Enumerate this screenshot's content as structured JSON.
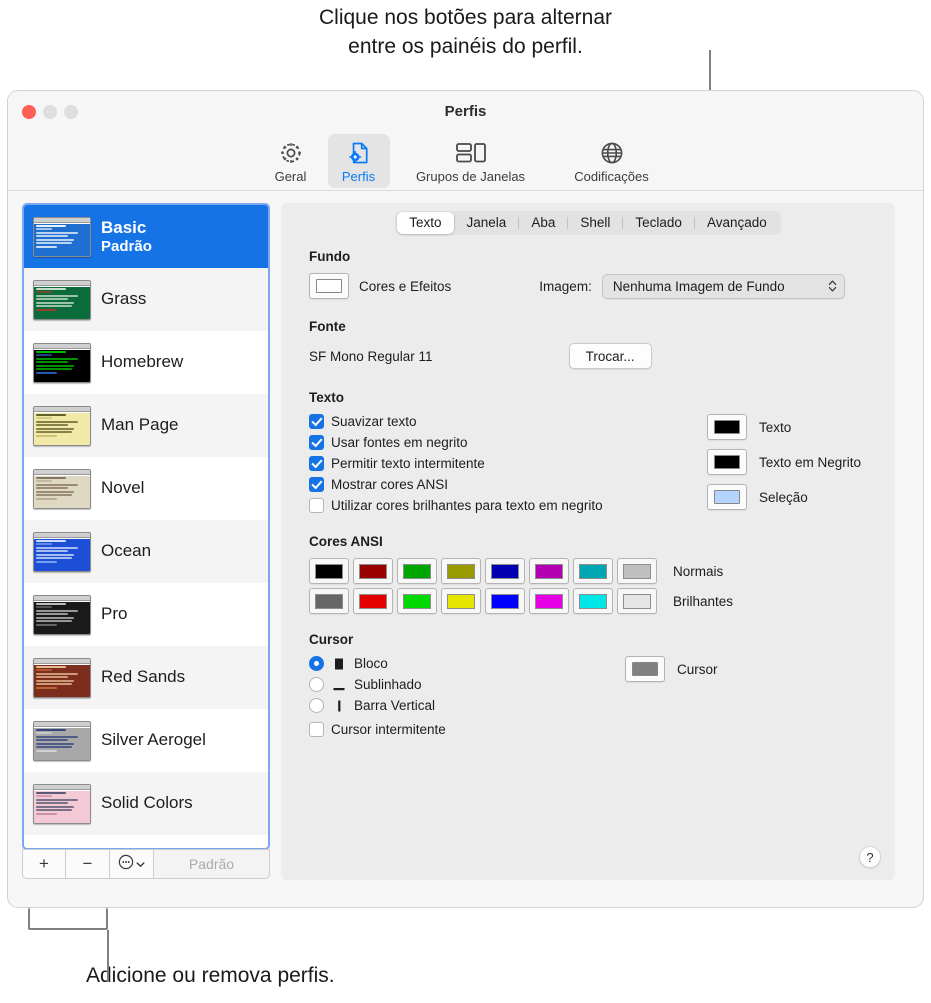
{
  "annotations": {
    "top": "Clique nos botões para alternar\nentre os painéis do perfil.",
    "bottom": "Adicione ou remova perfis."
  },
  "window": {
    "title": "Perfis",
    "traffic_lights": {
      "close": "#ff5f57",
      "minimize": "#dedede",
      "maximize": "#dedede"
    }
  },
  "toolbar": {
    "items": [
      {
        "label": "Geral",
        "icon": "gear-icon",
        "selected": false
      },
      {
        "label": "Perfis",
        "icon": "document-gear-icon",
        "selected": true
      },
      {
        "label": "Grupos de Janelas",
        "icon": "window-groups-icon",
        "selected": false
      },
      {
        "label": "Codificações",
        "icon": "globe-icon",
        "selected": false
      }
    ],
    "accent": "#0a7cf5"
  },
  "profiles": {
    "items": [
      {
        "name": "Basic",
        "subtitle": "Padrão",
        "selected": true,
        "thumb": {
          "bg": "#1f6fd0",
          "fg": "#ffffff",
          "accent": "#dfe9f7"
        }
      },
      {
        "name": "Grass",
        "subtitle": "",
        "selected": false,
        "thumb": {
          "bg": "#0c6b3a",
          "fg": "#d8e8d8",
          "accent": "#9d3f2f"
        }
      },
      {
        "name": "Homebrew",
        "subtitle": "",
        "selected": false,
        "thumb": {
          "bg": "#000000",
          "fg": "#00d000",
          "accent": "#2b5fc8"
        }
      },
      {
        "name": "Man Page",
        "subtitle": "",
        "selected": false,
        "thumb": {
          "bg": "#f2e9a8",
          "fg": "#55521f",
          "accent": "#c9bd72"
        }
      },
      {
        "name": "Novel",
        "subtitle": "",
        "selected": false,
        "thumb": {
          "bg": "#dfd9c3",
          "fg": "#7a6a55",
          "accent": "#b5a98e"
        }
      },
      {
        "name": "Ocean",
        "subtitle": "",
        "selected": false,
        "thumb": {
          "bg": "#1d4fd6",
          "fg": "#e3ecfb",
          "accent": "#7fa6ef"
        }
      },
      {
        "name": "Pro",
        "subtitle": "",
        "selected": false,
        "thumb": {
          "bg": "#1a1a1a",
          "fg": "#cfcfcf",
          "accent": "#6e6e6e"
        }
      },
      {
        "name": "Red Sands",
        "subtitle": "",
        "selected": false,
        "thumb": {
          "bg": "#7c2d1c",
          "fg": "#f0c9a0",
          "accent": "#c4693c"
        }
      },
      {
        "name": "Silver Aerogel",
        "subtitle": "",
        "selected": false,
        "thumb": {
          "bg": "#a8a8a8",
          "fg": "#2b3c7a",
          "accent": "#d4d4d4"
        }
      },
      {
        "name": "Solid Colors",
        "subtitle": "",
        "selected": false,
        "thumb": {
          "bg": "#f2c9d4",
          "fg": "#4a4a6a",
          "accent": "#c78ba0"
        }
      }
    ],
    "toolbar": {
      "add": "+",
      "remove": "−",
      "actions": "actions-menu",
      "default_label": "Padrão"
    }
  },
  "tabs": {
    "items": [
      "Texto",
      "Janela",
      "Aba",
      "Shell",
      "Teclado",
      "Avançado"
    ],
    "active": "Texto"
  },
  "settings": {
    "background": {
      "title": "Fundo",
      "colors_effects_label": "Cores e Efeitos",
      "image_label": "Imagem:",
      "image_value": "Nenhuma Imagem de Fundo",
      "swatch_color": "#ffffff"
    },
    "font": {
      "title": "Fonte",
      "value": "SF Mono Regular 11",
      "change_button": "Trocar..."
    },
    "text": {
      "title": "Texto",
      "checkboxes": [
        {
          "label": "Suavizar texto",
          "checked": true
        },
        {
          "label": "Usar fontes em negrito",
          "checked": true
        },
        {
          "label": "Permitir texto intermitente",
          "checked": true
        },
        {
          "label": "Mostrar cores ANSI",
          "checked": true
        },
        {
          "label": "Utilizar cores brilhantes para texto em negrito",
          "checked": false
        }
      ],
      "swatches": [
        {
          "label": "Texto",
          "color": "#000000"
        },
        {
          "label": "Texto em Negrito",
          "color": "#000000"
        },
        {
          "label": "Seleção",
          "color": "#b3d4fc"
        }
      ]
    },
    "ansi": {
      "title": "Cores ANSI",
      "normal_label": "Normais",
      "bright_label": "Brilhantes",
      "normal": [
        "#000000",
        "#990000",
        "#00a600",
        "#999900",
        "#0000b2",
        "#b200b2",
        "#00a6b2",
        "#bfbfbf"
      ],
      "bright": [
        "#666666",
        "#e50000",
        "#00d900",
        "#e5e500",
        "#0000ff",
        "#e500e5",
        "#00e5e5",
        "#e5e5e5"
      ]
    },
    "cursor": {
      "title": "Cursor",
      "options": [
        {
          "label": "Bloco",
          "glyph": "block-cursor-icon",
          "selected": true
        },
        {
          "label": "Sublinhado",
          "glyph": "underline-cursor-icon",
          "selected": false
        },
        {
          "label": "Barra Vertical",
          "glyph": "vertical-bar-cursor-icon",
          "selected": false
        }
      ],
      "blink": {
        "label": "Cursor intermitente",
        "checked": false
      },
      "swatch": {
        "label": "Cursor",
        "color": "#808080"
      }
    },
    "help_button": "?"
  }
}
